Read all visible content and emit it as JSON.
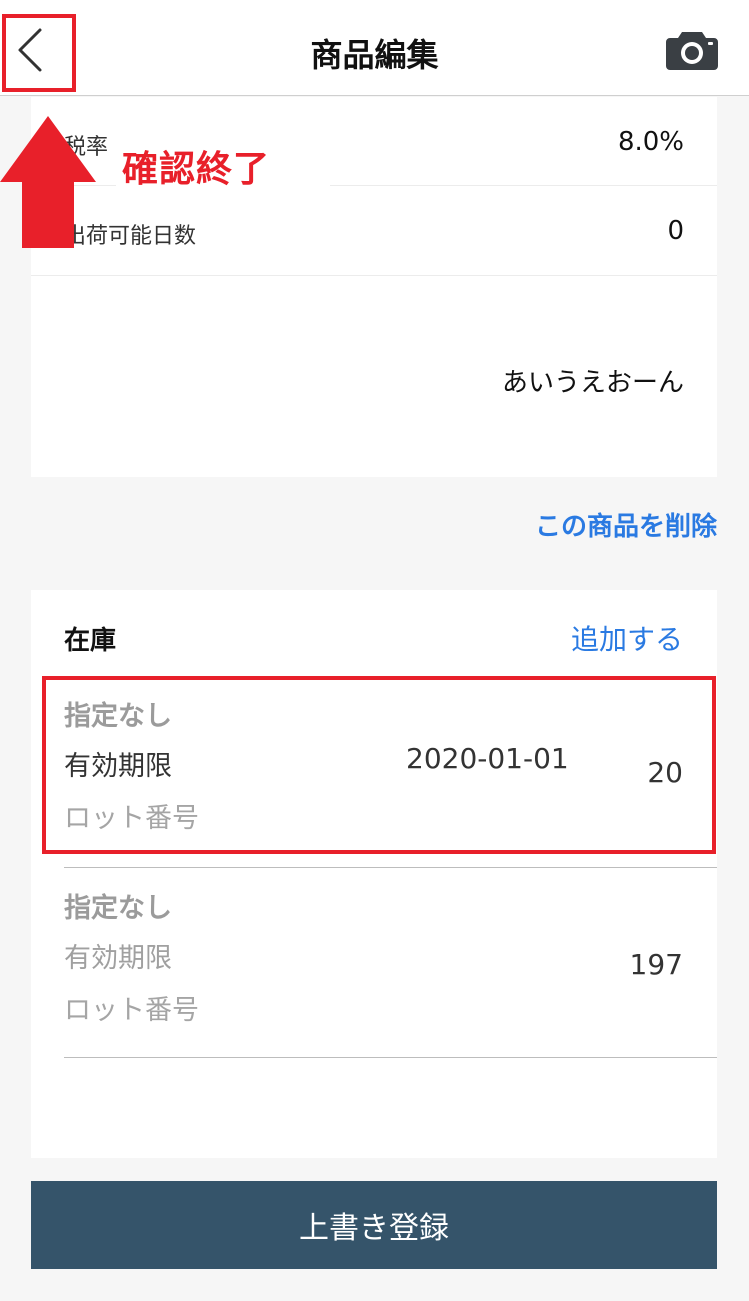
{
  "header": {
    "title": "商品編集",
    "back_icon": "chevron-left-icon",
    "camera_icon": "camera-icon"
  },
  "annotation": {
    "label": "確認終了",
    "color": "#e8202a"
  },
  "settings": {
    "tax_rate": {
      "label": "税率",
      "value": "8.0%"
    },
    "ship_days": {
      "label": "出荷可能日数",
      "value": "0"
    },
    "memo": {
      "value": "あいうえおーん"
    }
  },
  "delete_link": "この商品を削除",
  "stock": {
    "title": "在庫",
    "add_label": "追加する",
    "lots": [
      {
        "designation": "指定なし",
        "expiry_label": "有効期限",
        "expiry_date": "2020-01-01",
        "lot_label": "ロット番号",
        "quantity": "20"
      },
      {
        "designation": "指定なし",
        "expiry_label": "有効期限",
        "expiry_date": "",
        "lot_label": "ロット番号",
        "quantity": "197"
      }
    ]
  },
  "submit_label": "上書き登録",
  "colors": {
    "accent_blue": "#2a7ae2",
    "button_bg": "#35546a",
    "annotation_red": "#e8202a"
  }
}
